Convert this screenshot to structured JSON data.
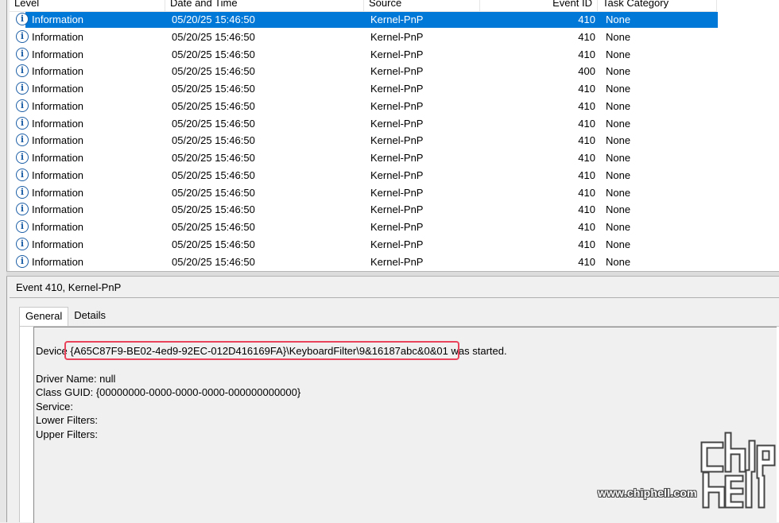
{
  "columns": {
    "level": "Level",
    "date": "Date and Time",
    "source": "Source",
    "event_id": "Event ID",
    "task": "Task Category"
  },
  "rows": [
    {
      "level": "Information",
      "date": "05/20/25 15:46:50",
      "source": "Kernel-PnP",
      "event_id": "410",
      "task": "None",
      "selected": true
    },
    {
      "level": "Information",
      "date": "05/20/25 15:46:50",
      "source": "Kernel-PnP",
      "event_id": "410",
      "task": "None"
    },
    {
      "level": "Information",
      "date": "05/20/25 15:46:50",
      "source": "Kernel-PnP",
      "event_id": "410",
      "task": "None"
    },
    {
      "level": "Information",
      "date": "05/20/25 15:46:50",
      "source": "Kernel-PnP",
      "event_id": "400",
      "task": "None"
    },
    {
      "level": "Information",
      "date": "05/20/25 15:46:50",
      "source": "Kernel-PnP",
      "event_id": "410",
      "task": "None"
    },
    {
      "level": "Information",
      "date": "05/20/25 15:46:50",
      "source": "Kernel-PnP",
      "event_id": "410",
      "task": "None"
    },
    {
      "level": "Information",
      "date": "05/20/25 15:46:50",
      "source": "Kernel-PnP",
      "event_id": "410",
      "task": "None"
    },
    {
      "level": "Information",
      "date": "05/20/25 15:46:50",
      "source": "Kernel-PnP",
      "event_id": "410",
      "task": "None"
    },
    {
      "level": "Information",
      "date": "05/20/25 15:46:50",
      "source": "Kernel-PnP",
      "event_id": "410",
      "task": "None"
    },
    {
      "level": "Information",
      "date": "05/20/25 15:46:50",
      "source": "Kernel-PnP",
      "event_id": "410",
      "task": "None"
    },
    {
      "level": "Information",
      "date": "05/20/25 15:46:50",
      "source": "Kernel-PnP",
      "event_id": "410",
      "task": "None"
    },
    {
      "level": "Information",
      "date": "05/20/25 15:46:50",
      "source": "Kernel-PnP",
      "event_id": "410",
      "task": "None"
    },
    {
      "level": "Information",
      "date": "05/20/25 15:46:50",
      "source": "Kernel-PnP",
      "event_id": "410",
      "task": "None"
    },
    {
      "level": "Information",
      "date": "05/20/25 15:46:50",
      "source": "Kernel-PnP",
      "event_id": "410",
      "task": "None"
    },
    {
      "level": "Information",
      "date": "05/20/25 15:46:50",
      "source": "Kernel-PnP",
      "event_id": "410",
      "task": "None"
    }
  ],
  "icon": "info-icon",
  "detail": {
    "title": "Event 410, Kernel-PnP",
    "tabs": [
      "General",
      "Details"
    ],
    "active_tab": "General",
    "lines": [
      "Device {A65C87F9-BE02-4ed9-92EC-012D416169FA}\\KeyboardFilter\\9&16187abc&0&01 was started.",
      "",
      "Driver Name: null",
      "Class GUID: {00000000-0000-0000-0000-000000000000}",
      "Service:",
      "Lower Filters:",
      "Upper Filters:"
    ]
  },
  "watermark": {
    "site": "www.chiphell.com",
    "logo": "chiphell-logo"
  },
  "colors": {
    "selection": "#0078d7",
    "highlight_box": "#e8435a"
  }
}
